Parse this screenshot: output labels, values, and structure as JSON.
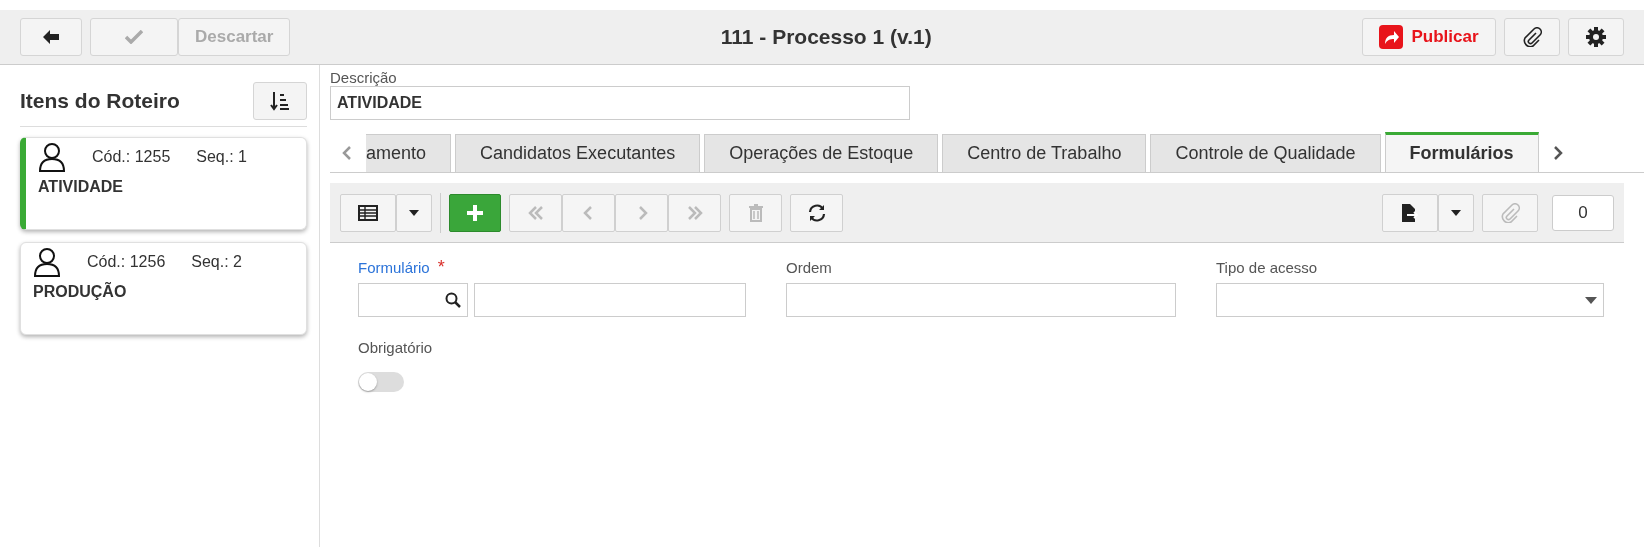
{
  "header": {
    "discard": "Descartar",
    "title": "111 - Processo 1 (v.1)",
    "publish": "Publicar"
  },
  "sidebar": {
    "title": "Itens do Roteiro",
    "items": [
      {
        "code": "Cód.: 1255",
        "seq": "Seq.: 1",
        "name": "ATIVIDADE",
        "selected": true
      },
      {
        "code": "Cód.: 1256",
        "seq": "Seq.: 2",
        "name": "PRODUÇÃO",
        "selected": false
      }
    ]
  },
  "description": {
    "label": "Descrição",
    "value": "ATIVIDADE"
  },
  "tabs": [
    {
      "label": "amento",
      "selected": false
    },
    {
      "label": "Candidatos Executantes",
      "selected": false
    },
    {
      "label": "Operações de Estoque",
      "selected": false
    },
    {
      "label": "Centro de Trabalho",
      "selected": false
    },
    {
      "label": "Controle de Qualidade",
      "selected": false
    },
    {
      "label": "Formulários",
      "selected": true
    }
  ],
  "toolbar": {
    "attachment_count": "0"
  },
  "form": {
    "formulario_label": "Formulário",
    "required_mark": "*",
    "ordem_label": "Ordem",
    "tipo_label": "Tipo de acesso",
    "obrigatorio_label": "Obrigatório",
    "obrigatorio_on": false
  }
}
